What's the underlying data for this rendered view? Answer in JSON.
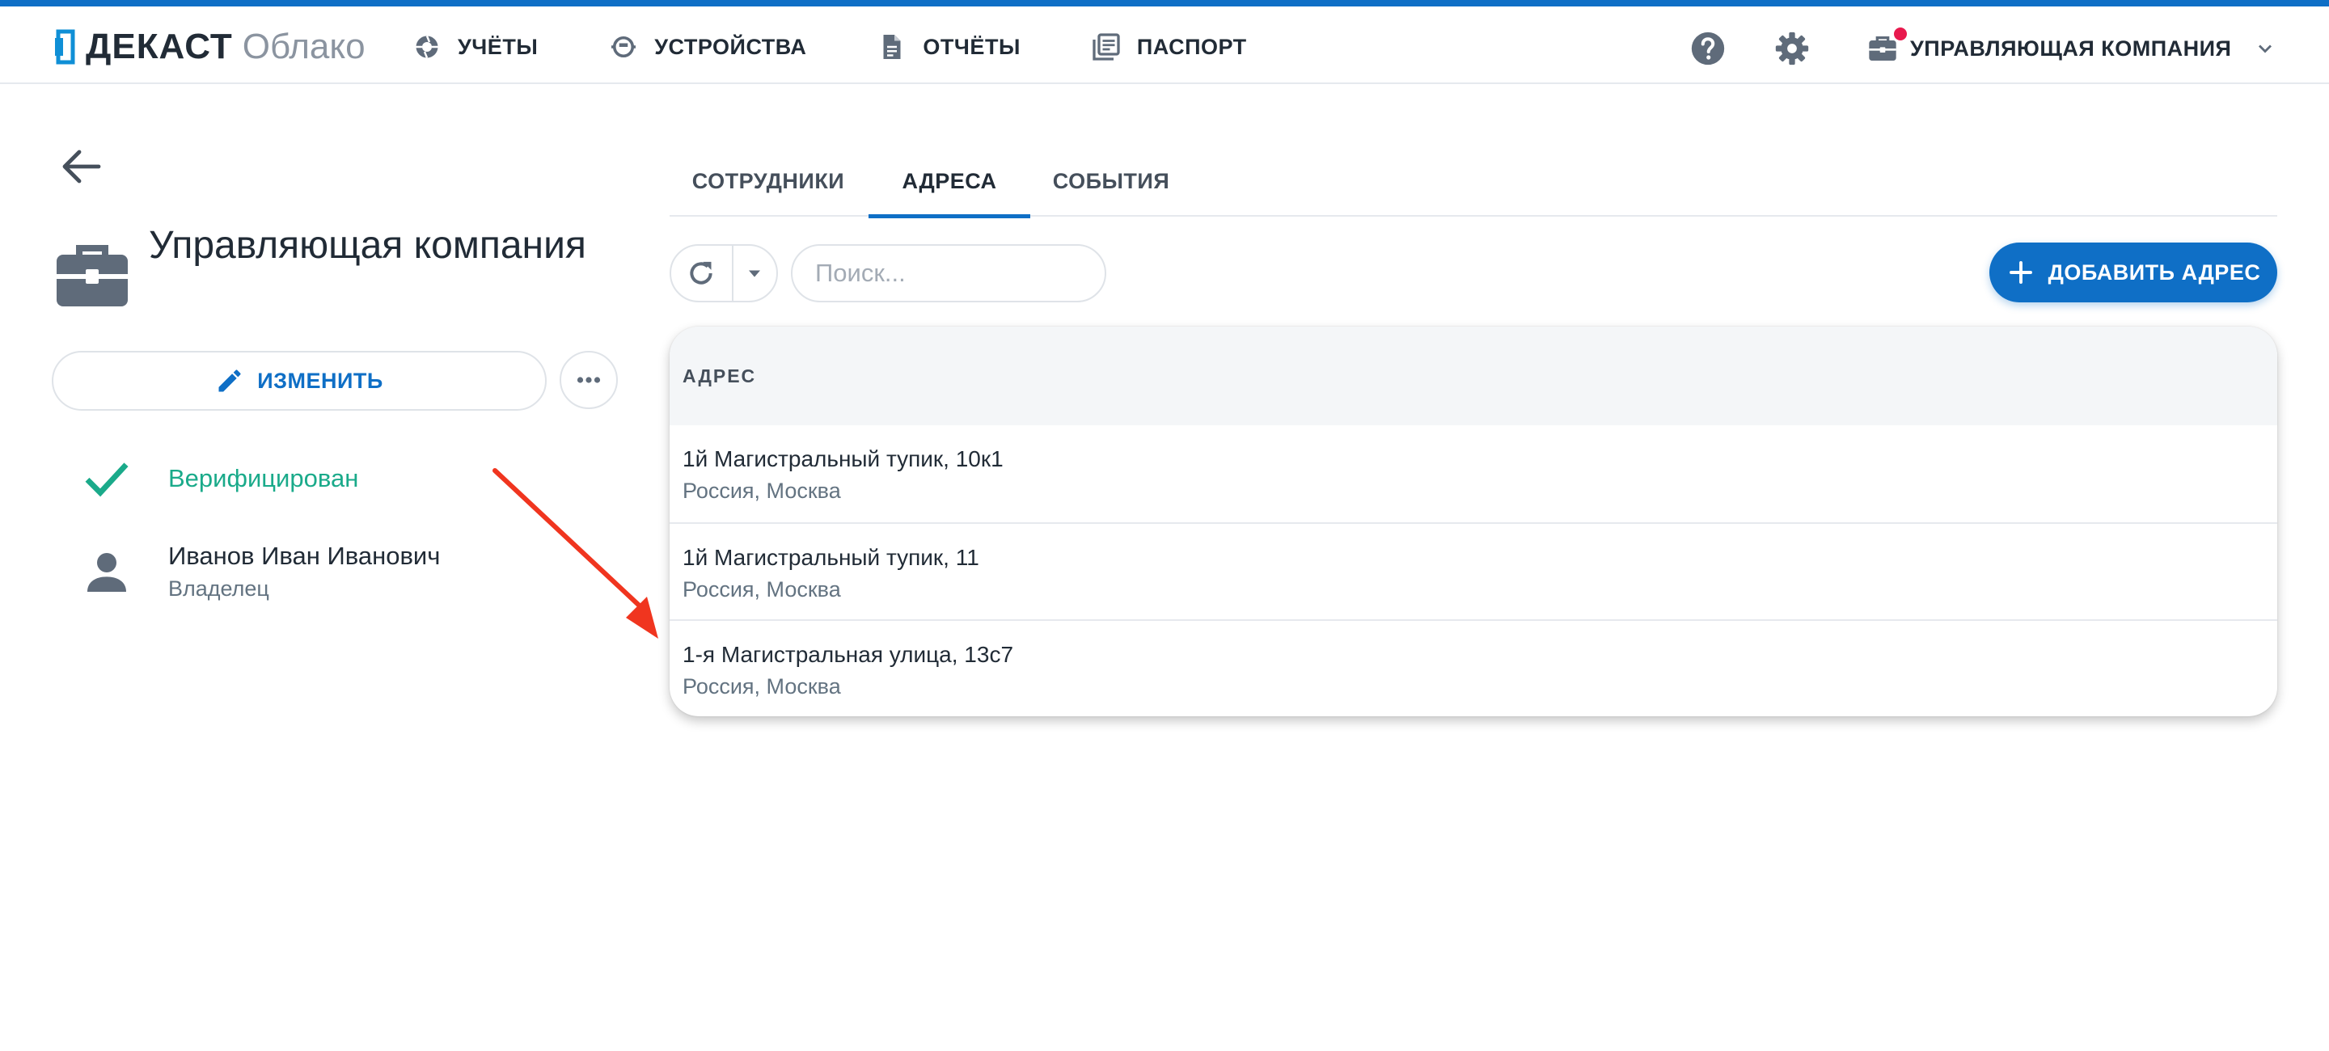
{
  "brand": {
    "name": "ДЕКАСТ",
    "product": "Облако"
  },
  "nav": [
    {
      "id": "accounts",
      "label": "УЧЁТЫ"
    },
    {
      "id": "devices",
      "label": "УСТРОЙСТВА"
    },
    {
      "id": "reports",
      "label": "ОТЧЁТЫ"
    },
    {
      "id": "passport",
      "label": "ПАСПОРТ"
    }
  ],
  "header": {
    "company_label": "УПРАВЛЯЮЩАЯ КОМПАНИЯ"
  },
  "org": {
    "title": "Управляющая компания",
    "edit_label": "ИЗМЕНИТЬ",
    "status": "Верифицирован",
    "owner": {
      "name": "Иванов Иван Иванович",
      "role": "Владелец"
    }
  },
  "tabs": [
    {
      "id": "staff",
      "label": "СОТРУДНИКИ",
      "active": false
    },
    {
      "id": "addresses",
      "label": "АДРЕСА",
      "active": true
    },
    {
      "id": "events",
      "label": "СОБЫТИЯ",
      "active": false
    }
  ],
  "toolbar": {
    "search_placeholder": "Поиск...",
    "add_label": "ДОБАВИТЬ АДРЕС"
  },
  "table": {
    "header": "АДРЕС",
    "rows": [
      {
        "street": "1й Магистральный тупик, 10к1",
        "city": "Россия, Москва"
      },
      {
        "street": "1й Магистральный тупик, 11",
        "city": "Россия, Москва"
      },
      {
        "street": "1-я Магистральная улица, 13с7",
        "city": "Россия, Москва"
      }
    ]
  },
  "colors": {
    "accent": "#0f6fc6",
    "success": "#1aaa8a",
    "notification": "#e8194d",
    "annotation_arrow": "#f0351f"
  }
}
